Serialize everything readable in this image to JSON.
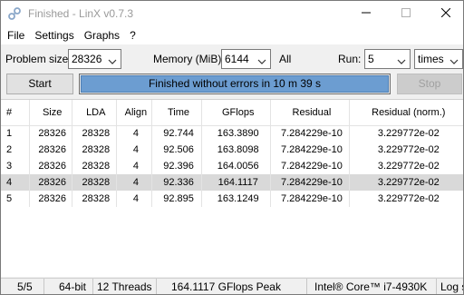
{
  "window": {
    "title": "Finished - LinX v0.7.3",
    "buttons": {
      "minimize": "minimize",
      "maximize": "maximize",
      "close": "close"
    }
  },
  "menu": [
    "File",
    "Settings",
    "Graphs",
    "?"
  ],
  "controls": {
    "problem_size_label": "Problem size:",
    "problem_size_value": "28326",
    "memory_label": "Memory (MiB):",
    "memory_value": "6144",
    "memory_all": "All",
    "run_label": "Run:",
    "run_value": "5",
    "times_value": "times"
  },
  "buttons": {
    "start": "Start",
    "stop": "Stop"
  },
  "progress": {
    "text": "Finished without errors in 10 m 39 s",
    "fraction": 1.0,
    "color": "#6c9dd1"
  },
  "table": {
    "headers": [
      "#",
      "Size",
      "LDA",
      "Align",
      "Time",
      "GFlops",
      "Residual",
      "Residual (norm.)"
    ],
    "rows": [
      [
        "1",
        "28326",
        "28328",
        "4",
        "92.744",
        "163.3890",
        "7.284229e-10",
        "3.229772e-02"
      ],
      [
        "2",
        "28326",
        "28328",
        "4",
        "92.506",
        "163.8098",
        "7.284229e-10",
        "3.229772e-02"
      ],
      [
        "3",
        "28326",
        "28328",
        "4",
        "92.396",
        "164.0056",
        "7.284229e-10",
        "3.229772e-02"
      ],
      [
        "4",
        "28326",
        "28328",
        "4",
        "92.336",
        "164.1117",
        "7.284229e-10",
        "3.229772e-02"
      ],
      [
        "5",
        "28326",
        "28328",
        "4",
        "92.895",
        "163.1249",
        "7.284229e-10",
        "3.229772e-02"
      ]
    ],
    "selected_row": 3
  },
  "status": {
    "count": "5/5",
    "bits": "64-bit",
    "threads": "12 Threads",
    "peak": "164.1117 GFlops Peak",
    "cpu": "Intel® Core™ i7-4930K",
    "log": "Log s"
  },
  "icons": {
    "app": "linx-app-icon",
    "dropdown": "chevron-down-icon"
  }
}
